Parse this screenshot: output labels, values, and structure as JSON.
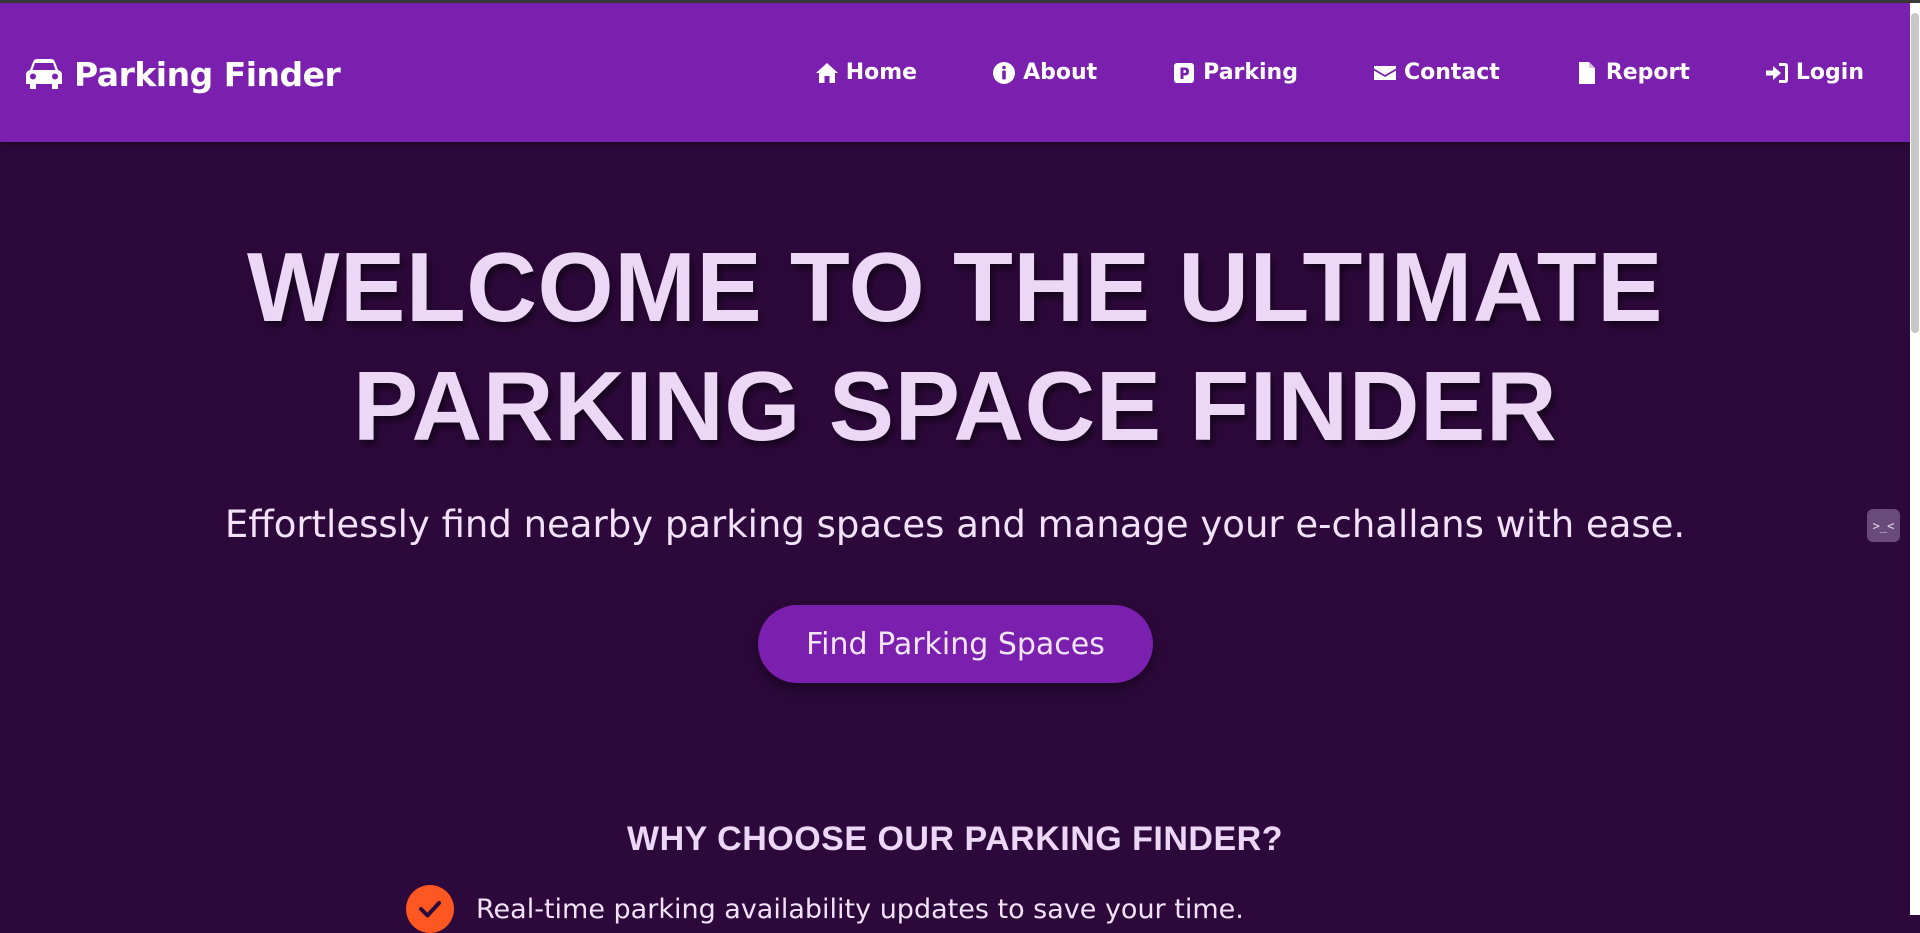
{
  "navbar": {
    "brand": "Parking Finder",
    "brand_icon": "car-icon",
    "items": [
      {
        "label": "Home",
        "icon": "home-icon"
      },
      {
        "label": "About",
        "icon": "info-circle-icon"
      },
      {
        "label": "Parking",
        "icon": "parking-sign-icon"
      },
      {
        "label": "Contact",
        "icon": "envelope-icon"
      },
      {
        "label": "Report",
        "icon": "document-icon"
      },
      {
        "label": "Login",
        "icon": "sign-in-icon"
      }
    ]
  },
  "hero": {
    "title_line1": "WELCOME TO THE ULTIMATE",
    "title_line2": "PARKING SPACE FINDER",
    "subtitle": "Effortlessly find nearby parking spaces and manage your e-challans with ease.",
    "cta_label": "Find Parking Spaces"
  },
  "why": {
    "title": "WHY CHOOSE OUR PARKING FINDER?",
    "features": [
      {
        "text": "Real-time parking availability updates to save your time."
      }
    ]
  },
  "devtools": {
    "label": ">_<"
  },
  "colors": {
    "navbar": "#7b1fae",
    "background": "#2d093b",
    "title_text": "#ecd7f7",
    "check_accent": "#ff5722"
  }
}
